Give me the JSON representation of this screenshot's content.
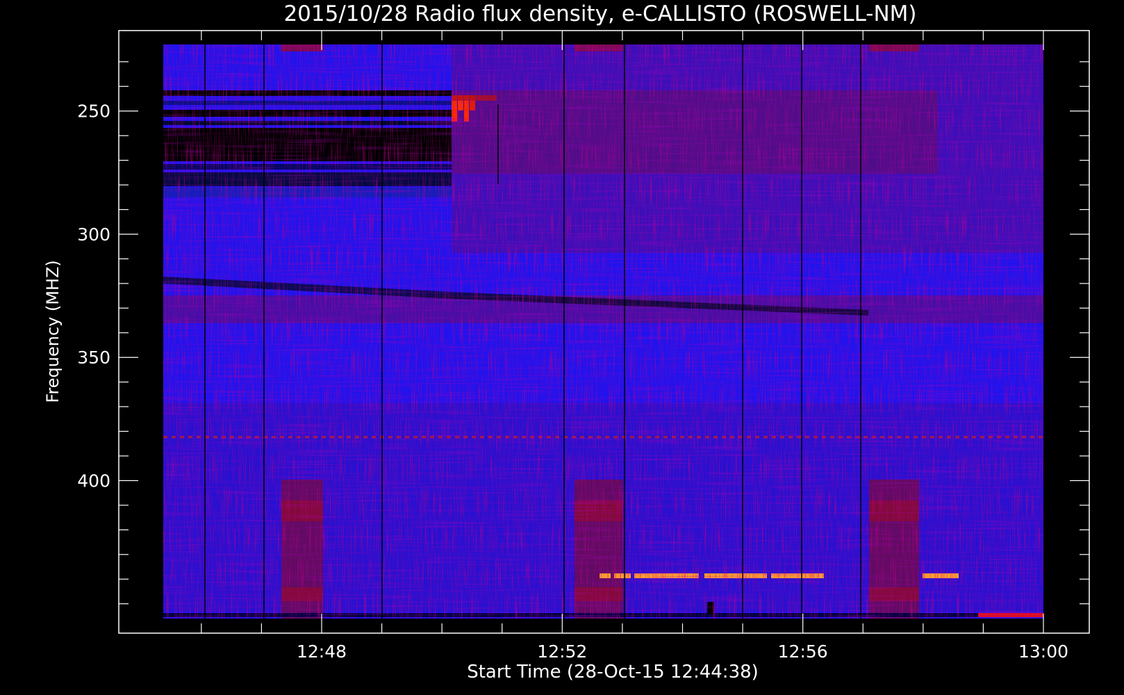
{
  "chart_data": {
    "type": "heatmap",
    "title": "2015/10/28  Radio flux density, e-CALLISTO (ROSWELL-NM)",
    "xlabel": "Start Time (28-Oct-15 12:44:38)",
    "ylabel": "Frequency (MHZ)",
    "x_range": [
      "12:44:38",
      "13:00:00"
    ],
    "y_range": [
      223,
      456
    ],
    "y_inverted": true,
    "x_ticks": [
      "12:48",
      "12:52",
      "12:56",
      "13:00"
    ],
    "y_ticks": [
      250,
      300,
      350,
      400
    ],
    "colormap": [
      "#000000",
      "#1010ff",
      "#3a0cd8",
      "#8a0a4a",
      "#ff2000",
      "#ffa030"
    ],
    "data_start": "12:45:22",
    "data_end": "13:00:00",
    "background_color": "#000000",
    "plot_color": "#2a10e0"
  }
}
